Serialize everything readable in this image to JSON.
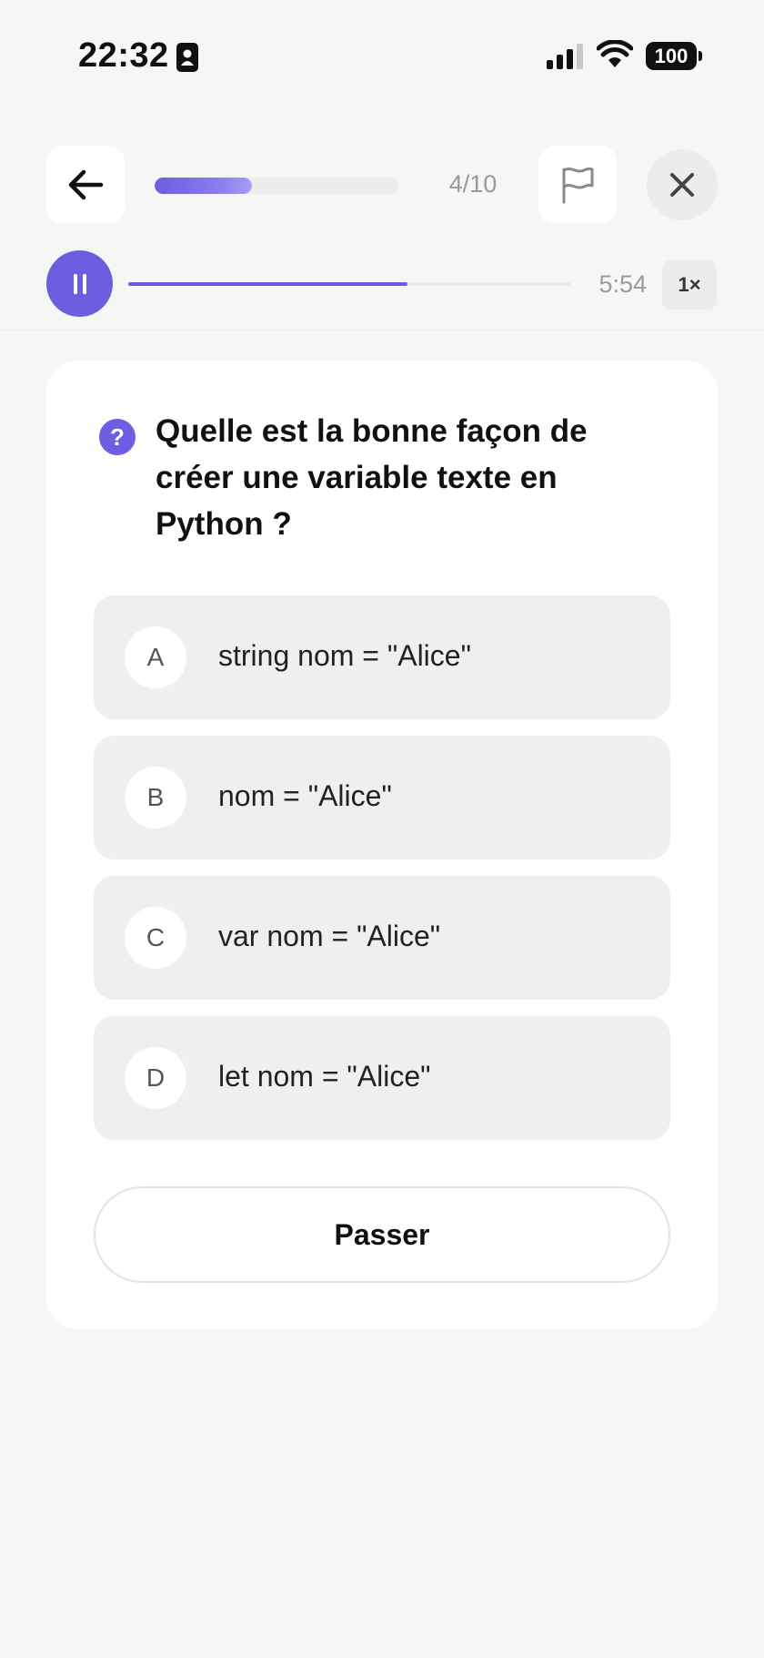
{
  "status_bar": {
    "time": "22:32",
    "battery": "100"
  },
  "header": {
    "progress_fraction": 0.4,
    "progress_count": "4/10"
  },
  "audio": {
    "time_remaining": "5:54",
    "speed": "1×",
    "playback_fraction": 0.63,
    "accent_color": "#6d5de0"
  },
  "question": {
    "icon": "question-mark-icon",
    "text": "Quelle est la bonne façon de créer une variable texte en Python ?",
    "options": [
      {
        "letter": "A",
        "text": "string nom = \"Alice\""
      },
      {
        "letter": "B",
        "text": "nom = \"Alice\""
      },
      {
        "letter": "C",
        "text": "var nom = \"Alice\""
      },
      {
        "letter": "D",
        "text": "let nom = \"Alice\""
      }
    ],
    "skip_label": "Passer"
  }
}
